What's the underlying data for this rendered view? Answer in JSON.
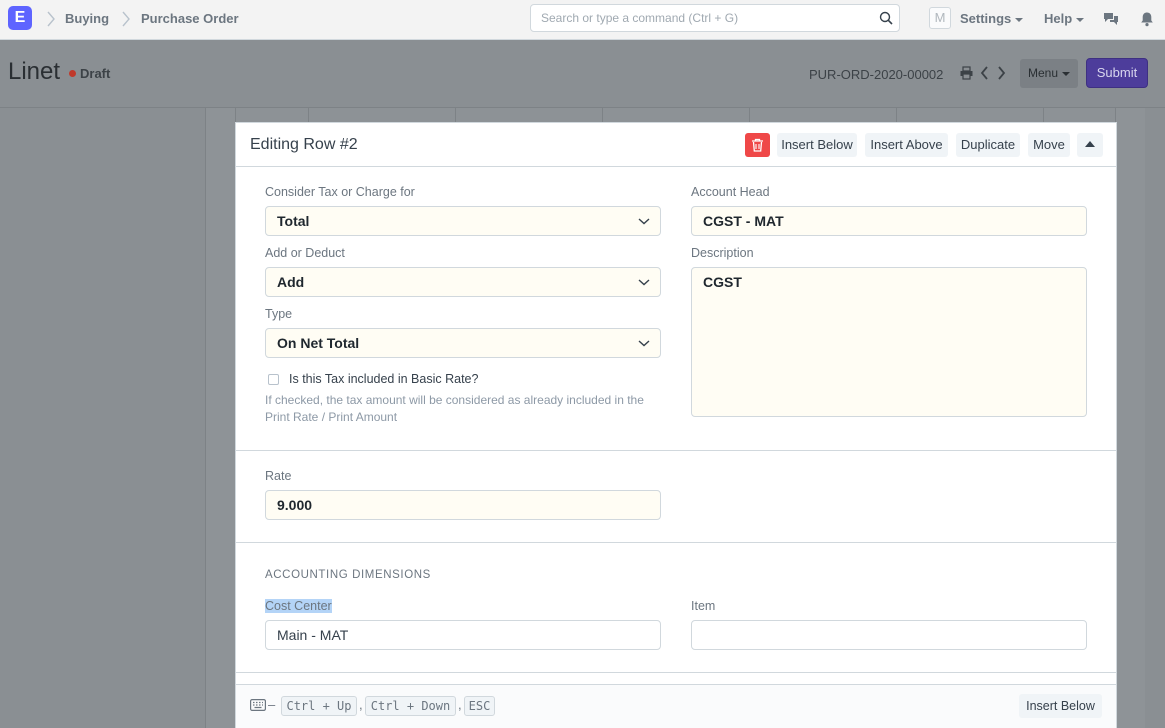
{
  "navbar": {
    "logo": "E",
    "breadcrumbs": [
      "Buying",
      "Purchase Order"
    ],
    "search_placeholder": "Search or type a command (Ctrl + G)",
    "avatar": "M",
    "settings_label": "Settings",
    "help_label": "Help"
  },
  "header": {
    "title": "Linet",
    "status": "Draft",
    "docname": "PUR-ORD-2020-00002",
    "menu_label": "Menu",
    "submit_label": "Submit"
  },
  "editor": {
    "title": "Editing Row #2",
    "buttons": {
      "insert_below": "Insert Below",
      "insert_above": "Insert Above",
      "duplicate": "Duplicate",
      "move": "Move"
    },
    "fields": {
      "consider_label": "Consider Tax or Charge for",
      "consider_value": "Total",
      "add_deduct_label": "Add or Deduct",
      "add_deduct_value": "Add",
      "type_label": "Type",
      "type_value": "On Net Total",
      "included_label": "Is this Tax included in Basic Rate?",
      "included_checked": false,
      "included_help": "If checked, the tax amount will be considered as already included in the Print Rate / Print Amount",
      "account_head_label": "Account Head",
      "account_head_value": "CGST - MAT",
      "description_label": "Description",
      "description_value": "CGST",
      "rate_label": "Rate",
      "rate_value": "9.000"
    },
    "accounting_dimensions": {
      "section_title": "ACCOUNTING DIMENSIONS",
      "cost_center_label": "Cost Center",
      "cost_center_value": "Main - MAT",
      "item_label": "Item",
      "item_value": ""
    },
    "footer": {
      "dash": "–",
      "shortcuts": [
        "Ctrl + Up",
        "Ctrl + Down",
        "ESC"
      ],
      "separator": ",",
      "insert_below": "Insert Below"
    }
  },
  "colors": {
    "primary": "#5e64ff",
    "delete": "#ef4848",
    "field_bg": "#fffdf4",
    "draft_dot": "#c0392b"
  }
}
